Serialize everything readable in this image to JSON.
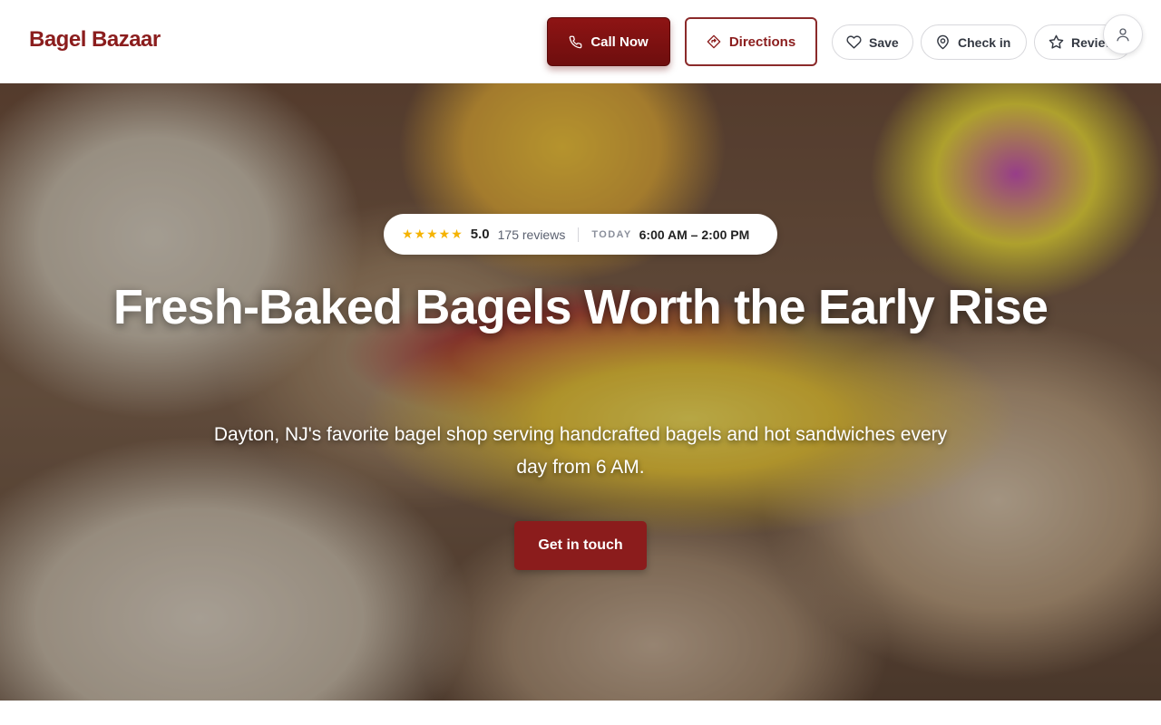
{
  "brand": {
    "name": "Bagel Bazaar"
  },
  "header": {
    "call_label": "Call Now",
    "directions_label": "Directions",
    "save_label": "Save",
    "checkin_label": "Check in",
    "review_label": "Review"
  },
  "hero": {
    "stars": "★★★★★",
    "rating": "5.0",
    "reviews": "175 reviews",
    "today_label": "TODAY",
    "hours": "6:00 AM – 2:00 PM",
    "headline": "Fresh-Baked Bagels Worth the Early Rise",
    "subhead": "Dayton, NJ's favorite bagel shop serving handcrafted bagels and hot sandwiches every day from 6 AM.",
    "cta_label": "Get in touch"
  },
  "icons": {
    "call": "phone-icon",
    "directions": "directions-icon",
    "save": "heart-icon",
    "checkin": "map-pin-icon",
    "review": "star-icon",
    "account": "user-icon"
  },
  "colors": {
    "brand": "#8b1d1d",
    "primary_button": "#7e1111",
    "cta": "#8b1c1c",
    "star": "#f5b301"
  }
}
